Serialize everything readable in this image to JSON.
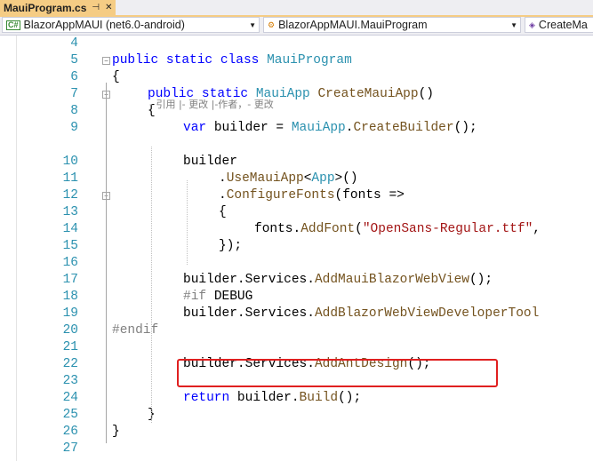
{
  "tab": {
    "title": "MauiProgram.cs",
    "pin_glyph": "⊣",
    "close_glyph": "✕"
  },
  "navbar": {
    "project": "BlazorAppMAUI (net6.0-android)",
    "type": "BlazorAppMAUI.MauiProgram",
    "member": "CreateMa"
  },
  "codelens": "- 引用 |- 更改 |-作者，- 更改",
  "highlight_color": "#e02020",
  "lines": [
    {
      "n": "4",
      "tokens": []
    },
    {
      "n": "5",
      "tokens": [
        [
          "kw",
          "public "
        ],
        [
          "kw",
          "static "
        ],
        [
          "kw",
          "class "
        ],
        [
          "ty",
          "MauiProgram"
        ]
      ]
    },
    {
      "n": "6",
      "tokens": [
        [
          "tx",
          "{"
        ]
      ]
    },
    {
      "n": "7",
      "tokens": [
        [
          "kw",
          "public "
        ],
        [
          "kw",
          "static "
        ],
        [
          "ty",
          "MauiApp "
        ],
        [
          "mt",
          "CreateMauiApp"
        ],
        [
          "tx",
          "()"
        ]
      ]
    },
    {
      "n": "8",
      "tokens": [
        [
          "tx",
          "{"
        ]
      ]
    },
    {
      "n": "9",
      "tokens": [
        [
          "kw",
          "var "
        ],
        [
          "tx",
          "builder = "
        ],
        [
          "ty",
          "MauiApp"
        ],
        [
          "tx",
          "."
        ],
        [
          "mt",
          "CreateBuilder"
        ],
        [
          "tx",
          "();"
        ]
      ]
    },
    {
      "n": "10",
      "tokens": [
        [
          "tx",
          "builder"
        ]
      ]
    },
    {
      "n": "11",
      "tokens": [
        [
          "tx",
          "."
        ],
        [
          "mt",
          "UseMauiApp"
        ],
        [
          "tx",
          "<"
        ],
        [
          "ty",
          "App"
        ],
        [
          "tx",
          ">()"
        ]
      ]
    },
    {
      "n": "12",
      "tokens": [
        [
          "tx",
          "."
        ],
        [
          "mt",
          "ConfigureFonts"
        ],
        [
          "tx",
          "("
        ],
        [
          "tx",
          "fonts =>"
        ]
      ]
    },
    {
      "n": "13",
      "tokens": [
        [
          "tx",
          "{"
        ]
      ]
    },
    {
      "n": "14",
      "tokens": [
        [
          "tx",
          "fonts."
        ],
        [
          "mt",
          "AddFont"
        ],
        [
          "tx",
          "("
        ],
        [
          "st",
          "\"OpenSans-Regular.ttf\""
        ],
        [
          "tx",
          ","
        ]
      ]
    },
    {
      "n": "15",
      "tokens": [
        [
          "tx",
          "});"
        ]
      ]
    },
    {
      "n": "16",
      "tokens": []
    },
    {
      "n": "17",
      "tokens": [
        [
          "tx",
          "builder."
        ],
        [
          "tx",
          "Services."
        ],
        [
          "mt",
          "AddMauiBlazorWebView"
        ],
        [
          "tx",
          "();"
        ]
      ]
    },
    {
      "n": "18",
      "tokens": [
        [
          "pp",
          "#if "
        ],
        [
          "tx",
          "DEBUG"
        ]
      ]
    },
    {
      "n": "19",
      "tokens": [
        [
          "tx",
          "builder."
        ],
        [
          "tx",
          "Services."
        ],
        [
          "mt",
          "AddBlazorWebViewDeveloperTool"
        ]
      ]
    },
    {
      "n": "20",
      "tokens": [
        [
          "pp",
          "#endif"
        ]
      ]
    },
    {
      "n": "21",
      "tokens": []
    },
    {
      "n": "22",
      "tokens": [
        [
          "tx",
          "builder."
        ],
        [
          "tx",
          "Services."
        ],
        [
          "mt",
          "AddAntDesign"
        ],
        [
          "tx",
          "();"
        ]
      ]
    },
    {
      "n": "23",
      "tokens": []
    },
    {
      "n": "24",
      "tokens": [
        [
          "kw",
          "return "
        ],
        [
          "tx",
          "builder."
        ],
        [
          "mt",
          "Build"
        ],
        [
          "tx",
          "();"
        ]
      ]
    },
    {
      "n": "25",
      "tokens": [
        [
          "tx",
          "}"
        ]
      ]
    },
    {
      "n": "26",
      "tokens": [
        [
          "tx",
          "}"
        ]
      ]
    },
    {
      "n": "27",
      "tokens": []
    }
  ]
}
